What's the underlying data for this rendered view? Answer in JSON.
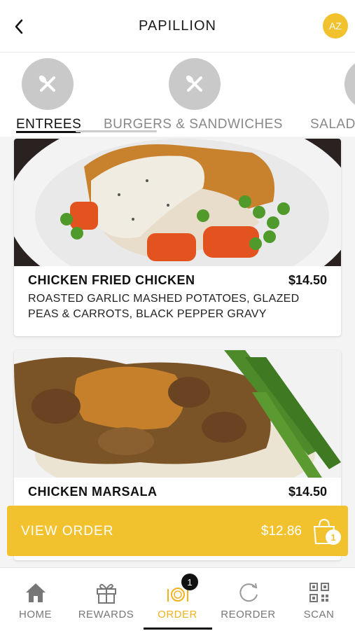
{
  "header": {
    "title": "PAPILLION",
    "avatar_initials": "AZ"
  },
  "categories": [
    {
      "label": "ENTREES",
      "active": true
    },
    {
      "label": "BURGERS & SANDWICHES",
      "active": false
    },
    {
      "label": "SALAD",
      "active": false
    }
  ],
  "menu_items": [
    {
      "name": "CHICKEN FRIED CHICKEN",
      "price": "$14.50",
      "description": "ROASTED GARLIC MASHED POTATOES, GLAZED PEAS & CARROTS, BLACK PEPPER GRAVY"
    },
    {
      "name": "CHICKEN MARSALA",
      "price": "$14.50"
    }
  ],
  "order_bar": {
    "label": "VIEW ORDER",
    "total": "$12.86",
    "count": "1"
  },
  "bottom_nav": [
    {
      "label": "HOME",
      "icon": "home-icon"
    },
    {
      "label": "REWARDS",
      "icon": "gift-icon"
    },
    {
      "label": "ORDER",
      "icon": "plate-icon",
      "badge": "1",
      "active": true
    },
    {
      "label": "REORDER",
      "icon": "reorder-icon"
    },
    {
      "label": "SCAN",
      "icon": "qr-icon"
    }
  ],
  "colors": {
    "accent": "#f2c22e",
    "text": "#111111",
    "muted": "#888888"
  }
}
